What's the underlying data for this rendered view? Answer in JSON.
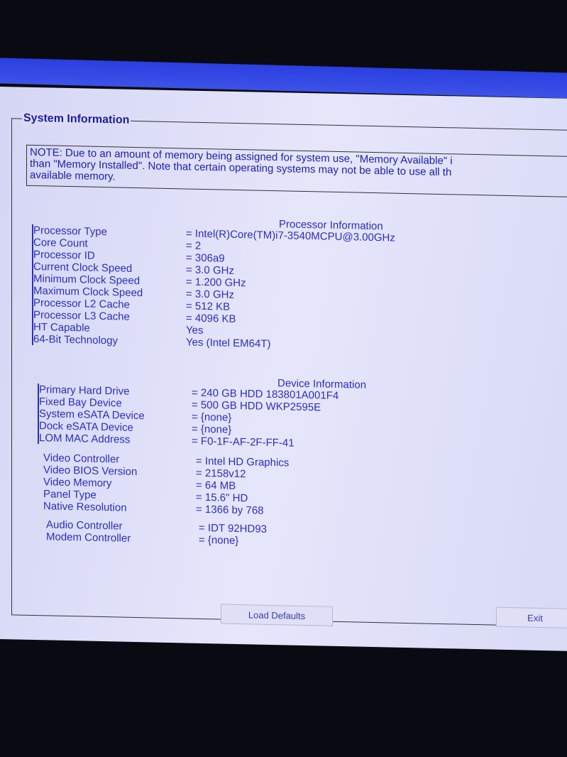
{
  "title": "System Information",
  "note": [
    "NOTE: Due to an amount of memory being assigned for system use, \"Memory Available\" i",
    "than \"Memory Installed\". Note that certain operating systems may not be able to use all th",
    "available memory."
  ],
  "processor": {
    "heading": "Processor Information",
    "rows": [
      {
        "label": "Processor Type",
        "value": "= Intel(R)Core(TM)i7-3540MCPU@3.00GHz"
      },
      {
        "label": "Core Count",
        "value": "= 2"
      },
      {
        "label": "Processor ID",
        "value": "= 306a9"
      },
      {
        "label": "Current Clock Speed",
        "value": "= 3.0 GHz"
      },
      {
        "label": "Minimum Clock Speed",
        "value": "= 1.200 GHz"
      },
      {
        "label": "Maximum Clock Speed",
        "value": "= 3.0 GHz"
      },
      {
        "label": "Processor L2 Cache",
        "value": "= 512 KB"
      },
      {
        "label": "Processor L3 Cache",
        "value": "= 4096 KB"
      },
      {
        "label": "HT Capable",
        "value": "Yes"
      },
      {
        "label": "64-Bit Technology",
        "value": "Yes (Intel EM64T)"
      }
    ]
  },
  "device": {
    "heading": "Device Information",
    "storage": [
      {
        "label": "Primary Hard Drive",
        "value": "= 240 GB HDD 183801A001F4"
      },
      {
        "label": "Fixed Bay Device",
        "value": "= 500 GB HDD WKP2595E"
      },
      {
        "label": "System eSATA Device",
        "value": "= {none}"
      },
      {
        "label": "Dock eSATA Device",
        "value": "= {none}"
      },
      {
        "label": "LOM MAC Address",
        "value": "= F0-1F-AF-2F-FF-41"
      }
    ],
    "video": [
      {
        "label": "Video Controller",
        "value": "= Intel HD Graphics"
      },
      {
        "label": "Video BIOS Version",
        "value": "= 2158v12"
      },
      {
        "label": "Video Memory",
        "value": "= 64 MB"
      },
      {
        "label": "Panel Type",
        "value": "= 15.6\" HD"
      },
      {
        "label": "Native Resolution",
        "value": "= 1366 by 768"
      }
    ],
    "audio": [
      {
        "label": "Audio Controller",
        "value": "= IDT 92HD93"
      },
      {
        "label": "Modem Controller",
        "value": "= {none}"
      }
    ]
  },
  "buttons": {
    "load_defaults": "Load Defaults",
    "exit": "Exit"
  }
}
